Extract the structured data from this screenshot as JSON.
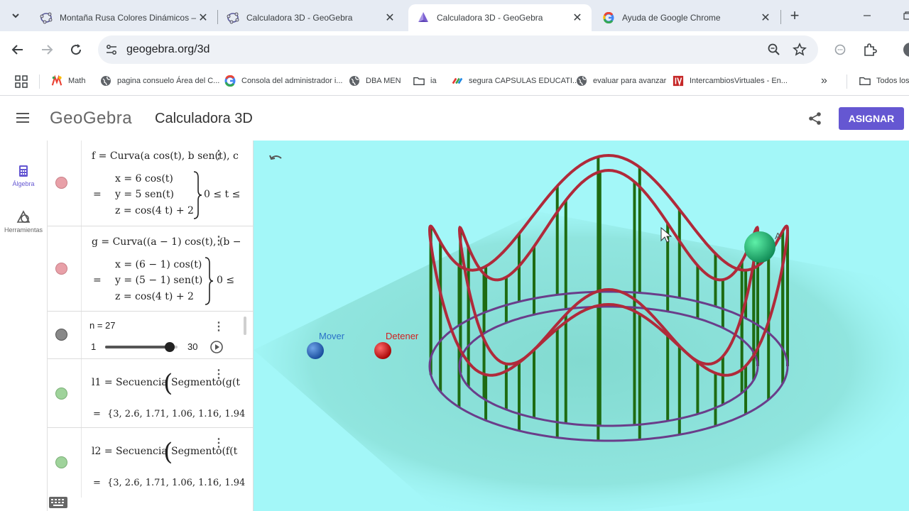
{
  "tabs": [
    {
      "title": "Montaña Rusa Colores Dinámicos – Geo",
      "icon": "geogebra-icon",
      "active": false
    },
    {
      "title": "Calculadora 3D - GeoGebra",
      "icon": "geogebra-icon",
      "active": false
    },
    {
      "title": "Calculadora 3D - GeoGebra",
      "icon": "geogebra-3d-icon",
      "active": true
    },
    {
      "title": "Ayuda de Google Chrome",
      "icon": "google-icon",
      "active": false
    }
  ],
  "toolbar": {
    "url": "geogebra.org/3d"
  },
  "bookmarks": [
    {
      "label": "Math",
      "icon": "math-icon"
    },
    {
      "label": "pagina consuelo Área del C...",
      "icon": "globe-icon"
    },
    {
      "label": "Consola del administrador i...",
      "icon": "google-icon"
    },
    {
      "label": "DBA MEN",
      "icon": "globe-icon"
    },
    {
      "label": "ia",
      "icon": "folder-icon"
    },
    {
      "label": "segura CAPSULAS EDUCATI...",
      "icon": "capsulas-icon"
    },
    {
      "label": "evaluar para avanzar",
      "icon": "globe-icon"
    },
    {
      "label": "IntercambiosVirtuales - En...",
      "icon": "iv-icon"
    },
    {
      "label": "Todos los",
      "icon": "folder-icon"
    }
  ],
  "header": {
    "logo": "GeoGebra",
    "title": "Calculadora 3D",
    "assign_label": "ASIGNAR"
  },
  "rail": {
    "algebra_label": "Álgebra",
    "tools_label": "Herramientas"
  },
  "algebra": {
    "f": {
      "definition": "f  =  Curva(a  cos(t), b  sen(t), c",
      "eq_sign": "=",
      "x": "x = 6  cos(t)",
      "y": "y = 5  sen(t)",
      "z": "z = cos(4 t) + 2",
      "range": "0 ≤ t ≤",
      "color": "#e8a0a8"
    },
    "g": {
      "definition": "g  =  Curva((a − 1)  cos(t), (b −",
      "eq_sign": "=",
      "x": "x = (6 − 1)  cos(t)",
      "y": "y = (5 − 1)  sen(t)",
      "z": "z = cos(4 t) + 2",
      "range": "0 ≤",
      "color": "#e8a0a8"
    },
    "n": {
      "label": "n = 27",
      "min": "1",
      "max": "30",
      "value": 27,
      "color": "#888888"
    },
    "l1": {
      "definition": "l1  =  Secuencia",
      "inner": "Segmento(g(t",
      "eq_sign": "=",
      "value": "{3, 2.6, 1.71, 1.06, 1.16, 1.94",
      "color": "#9fd39b"
    },
    "l2": {
      "definition": "l2  =  Secuencia",
      "inner": "Segmento(f(t",
      "eq_sign": "=",
      "value": "{3, 2.6, 1.71, 1.06, 1.16, 1.94",
      "color": "#9fd39b"
    }
  },
  "view3d": {
    "mover_label": "Mover",
    "detener_label": "Detener",
    "point_label": "A",
    "colors": {
      "background": "#a3f7f8",
      "track": "#b02a3a",
      "posts": "#1e6b12",
      "base": "#6a3d8a",
      "ball": "#1fc07a"
    }
  }
}
